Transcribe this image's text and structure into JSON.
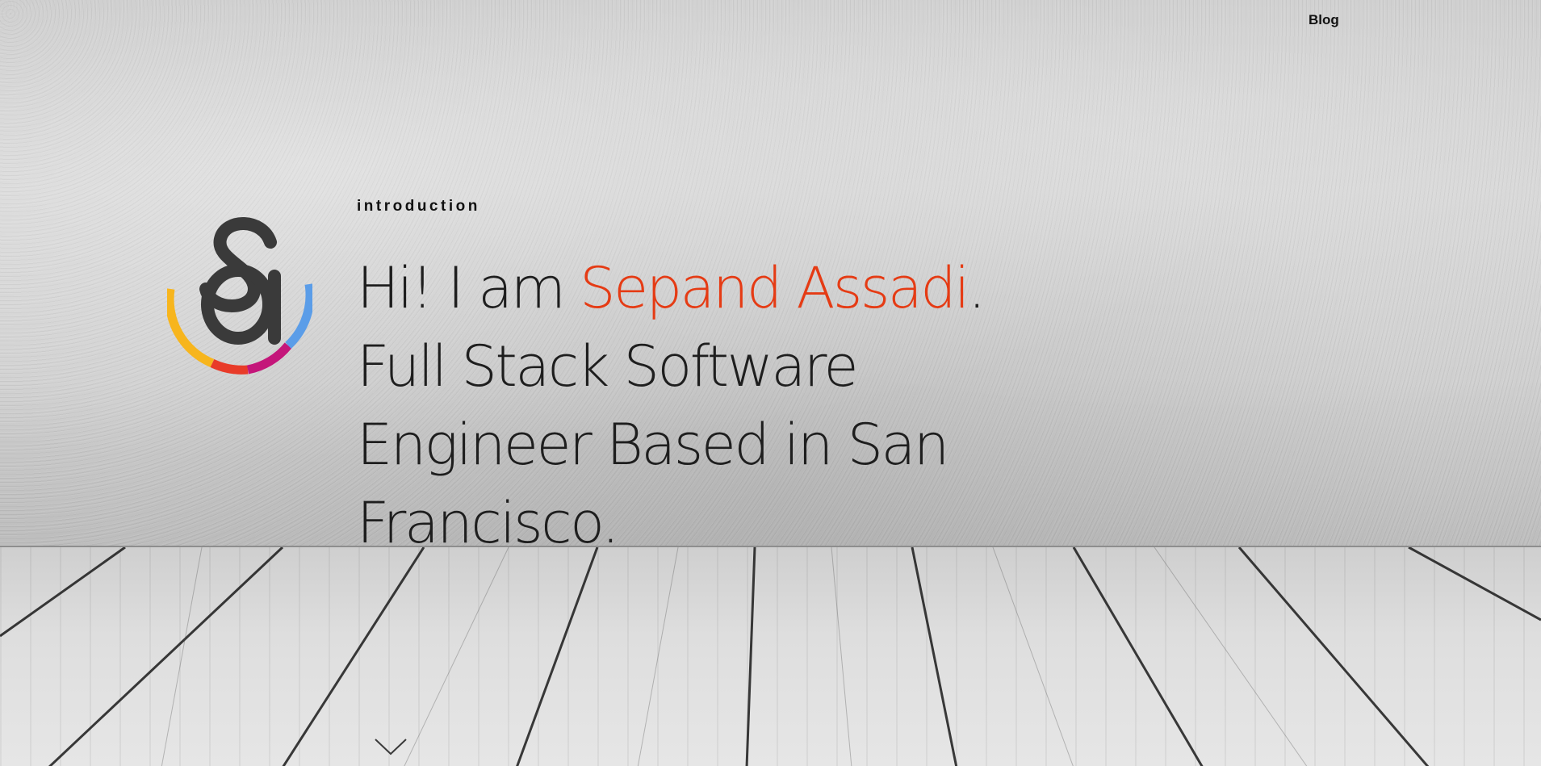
{
  "nav": {
    "blog_label": "Blog"
  },
  "logo": {
    "icon": "sa-monogram-logo",
    "monogram": "Sa",
    "colors": [
      "#f7b51d",
      "#f5871f",
      "#e83b29",
      "#c4167a",
      "#5b9de8"
    ]
  },
  "hero": {
    "section_label": "introduction",
    "greeting": "Hi! I am ",
    "name": "Sepand Assadi",
    "name_color": "#e53b14",
    "greeting_end": ".",
    "tagline_line1": "Full Stack Software",
    "tagline_line2": "Engineer Based in San",
    "tagline_line3": "Francisco."
  },
  "scroll": {
    "icon": "chevron-down-icon"
  }
}
